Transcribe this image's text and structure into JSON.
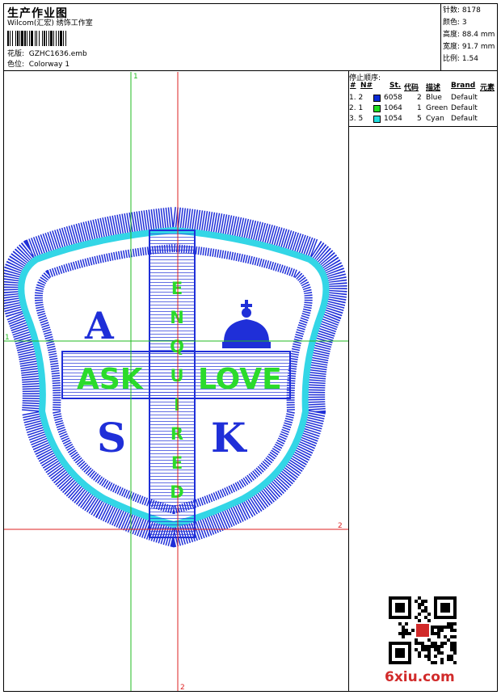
{
  "header": {
    "title": "生产作业图",
    "studio": "Wilcom(汇宏) 绣饰工作室",
    "design_label": "花版:",
    "design_value": "GZHC1636.emb",
    "colorway_label": "色位:",
    "colorway_value": "Colorway 1"
  },
  "stats": [
    {
      "label": "针数:",
      "value": "8178"
    },
    {
      "label": "颜色:",
      "value": "3"
    },
    {
      "label": "高度:",
      "value": "88.4 mm"
    },
    {
      "label": "宽度:",
      "value": "91.7 mm"
    },
    {
      "label": "比例:",
      "value": "1.54"
    }
  ],
  "stop_sequence": {
    "title": "停止顺序:",
    "columns": [
      "#",
      "N#",
      "St.",
      "代码",
      "描述",
      "Brand",
      "元素"
    ],
    "rows": [
      {
        "seq": "1. 2",
        "color": "#0b2bd6",
        "code": "6058",
        "stitches": "2",
        "desc": "Blue",
        "brand": "Default"
      },
      {
        "seq": "2. 1",
        "color": "#22dd22",
        "code": "1064",
        "stitches": "1",
        "desc": "Green",
        "brand": "Default"
      },
      {
        "seq": "3. 5",
        "color": "#22dddd",
        "code": "1054",
        "stitches": "5",
        "desc": "Cyan",
        "brand": "Default"
      }
    ]
  },
  "design": {
    "bar_left": "ASK",
    "bar_right": "LOVE",
    "vertical_text": "ENQUIRED",
    "quad_top_left": "A",
    "quad_bottom_left": "S",
    "quad_bottom_right": "K",
    "colors": {
      "blue": "#1f2fd8",
      "green": "#2bdb2b",
      "cyan": "#33d6e6"
    }
  },
  "guides": {
    "green_label": "1",
    "red_label": "2"
  },
  "watermark": "6xiu.com"
}
